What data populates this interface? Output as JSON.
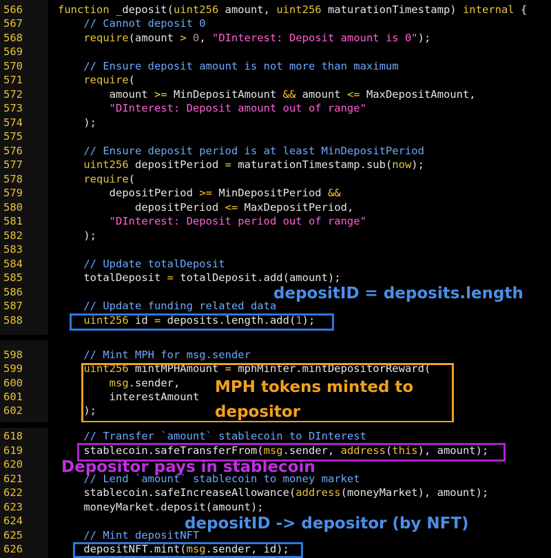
{
  "lines": [
    {
      "n": "566",
      "html": "<span class='kw'>function</span> _deposit(<span class='kw'>uint256</span> amount, <span class='kw'>uint256</span> maturationTimestamp) <span class='kw'>internal</span> {"
    },
    {
      "n": "567",
      "html": "    <span class='cm'>// Cannot deposit 0</span>"
    },
    {
      "n": "568",
      "html": "    <span class='kw'>require</span>(amount <span class='op'>&gt;</span> <span class='num'>0</span>, <span class='str'>\"DInterest: Deposit amount is 0\"</span>);"
    },
    {
      "n": "569",
      "html": ""
    },
    {
      "n": "570",
      "html": "    <span class='cm'>// Ensure deposit amount is not more than maximum</span>"
    },
    {
      "n": "571",
      "html": "    <span class='kw'>require</span>("
    },
    {
      "n": "572",
      "html": "        amount <span class='op'>&gt;=</span> MinDepositAmount <span class='op'>&amp;&amp;</span> amount <span class='op'>&lt;=</span> MaxDepositAmount,"
    },
    {
      "n": "573",
      "html": "        <span class='str'>\"DInterest: Deposit amount out of range\"</span>"
    },
    {
      "n": "574",
      "html": "    );"
    },
    {
      "n": "575",
      "html": ""
    },
    {
      "n": "576",
      "html": "    <span class='cm'>// Ensure deposit period is at least MinDepositPeriod</span>"
    },
    {
      "n": "577",
      "html": "    <span class='kw'>uint256</span> depositPeriod <span class='op'>=</span> maturationTimestamp.sub(<span class='kw'>now</span>);"
    },
    {
      "n": "578",
      "html": "    <span class='kw'>require</span>("
    },
    {
      "n": "579",
      "html": "        depositPeriod <span class='op'>&gt;=</span> MinDepositPeriod <span class='op'>&amp;&amp;</span>"
    },
    {
      "n": "580",
      "html": "            depositPeriod <span class='op'>&lt;=</span> MaxDepositPeriod,"
    },
    {
      "n": "581",
      "html": "        <span class='str'>\"DInterest: Deposit period out of range\"</span>"
    },
    {
      "n": "582",
      "html": "    );"
    },
    {
      "n": "583",
      "html": ""
    },
    {
      "n": "584",
      "html": "    <span class='cm'>// Update totalDeposit</span>"
    },
    {
      "n": "585",
      "html": "    totalDeposit <span class='op'>=</span> totalDeposit.add(amount);"
    },
    {
      "n": "586",
      "html": ""
    },
    {
      "n": "587",
      "html": "    <span class='cm'>// Update funding related data</span>"
    },
    {
      "n": "588",
      "html": "    <span class='kw'>uint256</span> id <span class='op'>=</span> deposits.length.add(<span class='num'>1</span>);"
    },
    {
      "n": "598",
      "html": "    <span class='cm'>// Mint MPH for msg.sender</span>"
    },
    {
      "n": "599",
      "html": "    <span class='kw'>uint256</span> mintMPHAmount <span class='op'>=</span> mphMinter.mintDepositorReward("
    },
    {
      "n": "600",
      "html": "        <span class='kw'>msg</span>.sender,"
    },
    {
      "n": "601",
      "html": "        interestAmount"
    },
    {
      "n": "602",
      "html": "    );"
    },
    {
      "n": "618",
      "html": "    <span class='cm'>// Transfer `amount` stablecoin to DInterest</span>"
    },
    {
      "n": "619",
      "html": "    stablecoin.safeTransferFrom(<span class='kw'>msg</span>.sender, <span class='kw'>address</span>(<span class='kw'>this</span>), amount);"
    },
    {
      "n": "620",
      "html": ""
    },
    {
      "n": "621",
      "html": "    <span class='cm'>// Lend `amount` stablecoin to money market</span>"
    },
    {
      "n": "622",
      "html": "    stablecoin.safeIncreaseAllowance(<span class='kw'>address</span>(moneyMarket), amount);"
    },
    {
      "n": "623",
      "html": "    moneyMarket.deposit(amount);"
    },
    {
      "n": "624",
      "html": ""
    },
    {
      "n": "625",
      "html": "    <span class='cm'>// Mint depositNFT</span>"
    },
    {
      "n": "626",
      "html": "    depositNFT.mint(<span class='kw'>msg</span>.sender, id);"
    }
  ],
  "annotations": {
    "deposit_id": "depositID = deposits.length",
    "mph_line1": "MPH tokens minted  to",
    "mph_line2": "depositor",
    "depositor_pays": "Depositor pays in stablecoin",
    "deposit_nft": "depositID -> depositor (by NFT)"
  },
  "colors": {
    "line_number": "#e8c33a",
    "keyword": "#e8c33a",
    "comment": "#6fa8ff",
    "string": "#ff5fd7",
    "box_blue": "#2f78e0",
    "box_orange": "#f0a020",
    "box_purple": "#b020d0",
    "note_blue": "#4a8fe8",
    "note_orange": "#f0a020",
    "note_purple": "#c030e0"
  }
}
